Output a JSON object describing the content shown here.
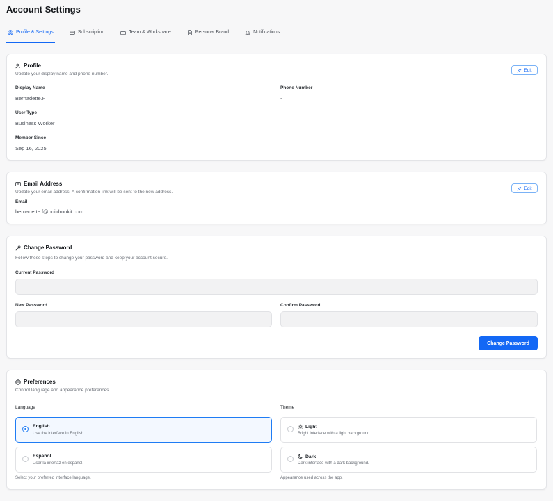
{
  "page": {
    "title": "Account Settings"
  },
  "tabs": [
    {
      "label": "Profile & Settings",
      "icon": "user-circle-icon",
      "active": true
    },
    {
      "label": "Subscription",
      "icon": "credit-card-icon"
    },
    {
      "label": "Team & Workspace",
      "icon": "briefcase-icon"
    },
    {
      "label": "Personal Brand",
      "icon": "document-icon"
    },
    {
      "label": "Notifications",
      "icon": "bell-icon"
    }
  ],
  "profile": {
    "title": "Profile",
    "subtitle": "Update your display name and phone number.",
    "edit_label": "Edit",
    "display_name_label": "Display Name",
    "display_name": "Bernadette.F",
    "phone_label": "Phone Number",
    "phone": "-",
    "user_type_label": "User Type",
    "user_type": "Business Worker",
    "member_since_label": "Member Since",
    "member_since": "Sep 16, 2025"
  },
  "email": {
    "title": "Email Address",
    "subtitle": "Update your email address. A confirmation link will be sent to the new address.",
    "edit_label": "Edit",
    "email_label": "Email",
    "email": "bernadette.f@buildrunkit.com"
  },
  "password": {
    "title": "Change Password",
    "subtitle": "Follow these steps to change your password and keep your account secure.",
    "current_label": "Current Password",
    "current_value": "",
    "new_label": "New Password",
    "new_value": "",
    "confirm_label": "Confirm Password",
    "confirm_value": "",
    "button_label": "Change Password"
  },
  "preferences": {
    "title": "Preferences",
    "subtitle": "Control language and appearance preferences",
    "language_label": "Language",
    "language_options": [
      {
        "title": "English",
        "desc": "Use the interface in English.",
        "selected": true
      },
      {
        "title": "Español",
        "desc": "Usar la interfaz en español.",
        "selected": false
      }
    ],
    "language_helper": "Select your preferred interface language.",
    "theme_label": "Theme",
    "theme_options": [
      {
        "title": "Light",
        "desc": "Bright interface with a light background.",
        "icon": "sun-icon",
        "selected": false
      },
      {
        "title": "Dark",
        "desc": "Dark interface with a dark background.",
        "icon": "moon-icon",
        "selected": false
      }
    ],
    "theme_helper": "Appearance used across the app."
  },
  "colors": {
    "accent": "#1368f5",
    "background": "#f7f7f8",
    "card": "#ffffff"
  }
}
